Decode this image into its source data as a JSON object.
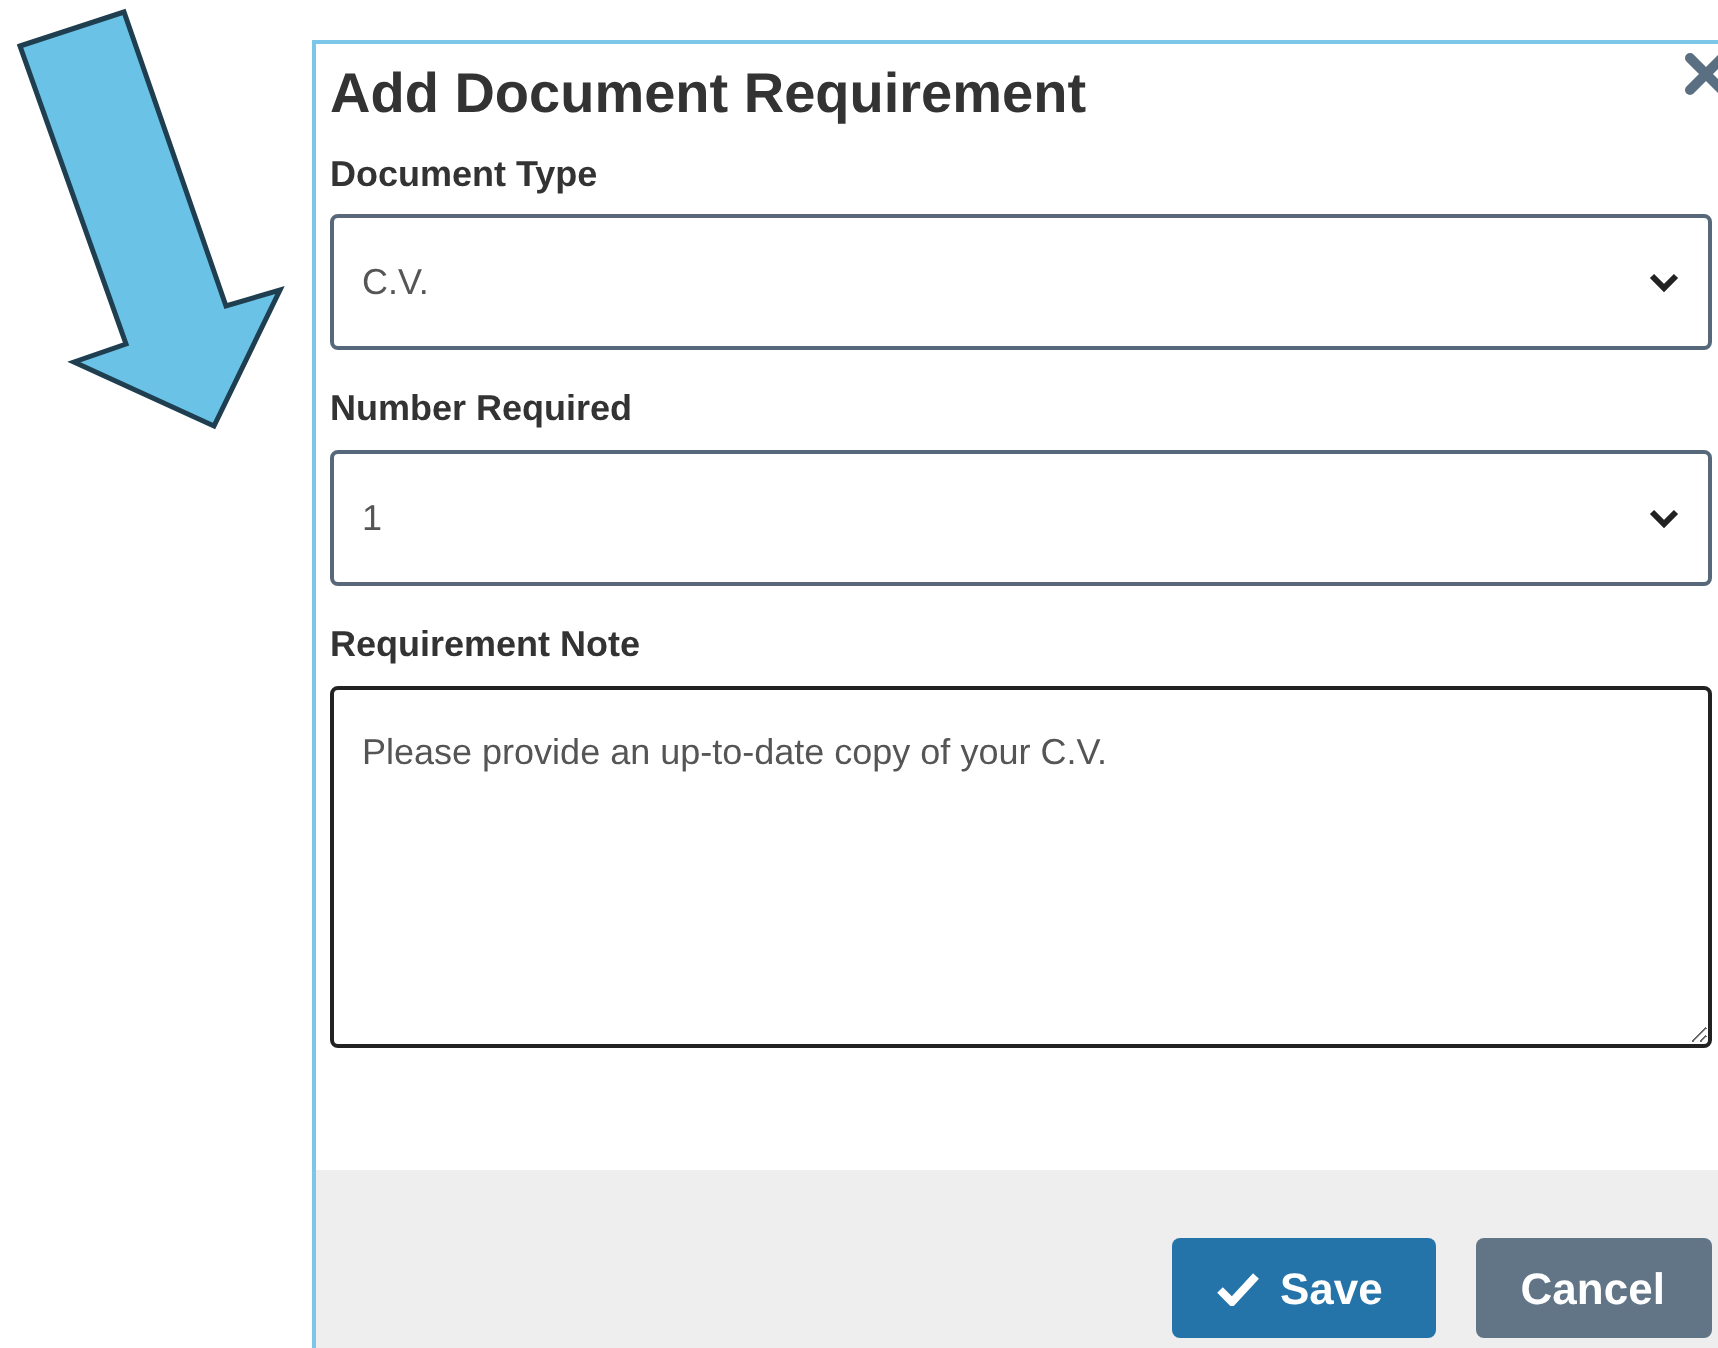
{
  "dialog": {
    "title": "Add Document Requirement",
    "fields": [
      {
        "kind": "select",
        "label": "Document Type",
        "value": "C.V."
      },
      {
        "kind": "select",
        "label": "Number Required",
        "value": "1"
      },
      {
        "kind": "textarea",
        "label": "Requirement Note",
        "value": "Please provide an up-to-date copy of your C.V."
      }
    ],
    "buttons": [
      {
        "kind": "primary",
        "label": "Save"
      },
      {
        "kind": "secondary",
        "label": "Cancel"
      }
    ]
  }
}
